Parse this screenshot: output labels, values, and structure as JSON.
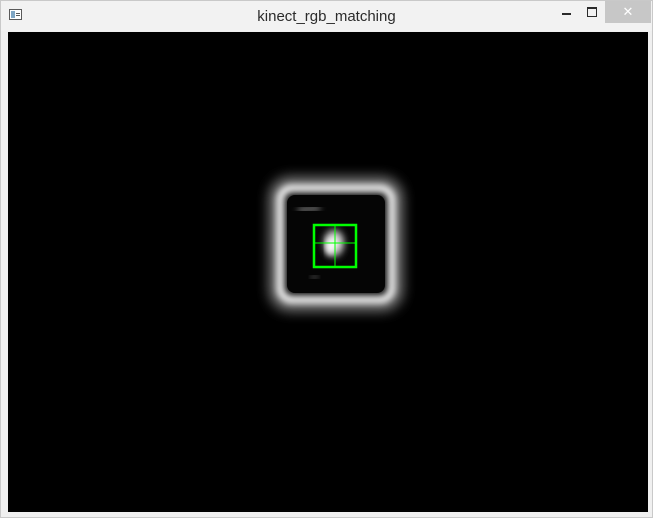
{
  "window": {
    "title": "kinect_rgb_matching",
    "app_icon": "window-app-icon",
    "controls": {
      "minimize_icon": "minimize-icon",
      "maximize_icon": "maximize-icon",
      "close_icon": "close-icon",
      "close_glyph": "✕"
    }
  },
  "image": {
    "background": "#000000",
    "tracking_box_color": "#00ff00"
  }
}
